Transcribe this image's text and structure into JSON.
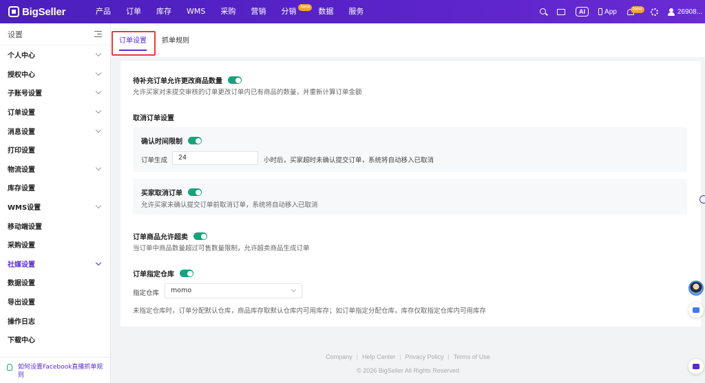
{
  "brand": {
    "name": "BigSeller"
  },
  "nav": {
    "items": [
      {
        "label": "产品"
      },
      {
        "label": "订单"
      },
      {
        "label": "库存"
      },
      {
        "label": "WMS"
      },
      {
        "label": "采购"
      },
      {
        "label": "营销"
      },
      {
        "label": "分销",
        "badge": "New"
      },
      {
        "label": "数据"
      },
      {
        "label": "服务"
      }
    ]
  },
  "topright": {
    "ai_label": "AI",
    "app_label": "App",
    "bell_badge": "New",
    "user_id": "26908..."
  },
  "sidebar": {
    "title": "设置",
    "items": [
      {
        "label": "个人中心",
        "chevron": true
      },
      {
        "label": "授权中心",
        "chevron": true
      },
      {
        "label": "子账号设置",
        "chevron": true
      },
      {
        "label": "订单设置",
        "chevron": true
      },
      {
        "label": "消息设置",
        "chevron": true
      },
      {
        "label": "打印设置",
        "chevron": false
      },
      {
        "label": "物流设置",
        "chevron": true
      },
      {
        "label": "库存设置",
        "chevron": false
      },
      {
        "label": "WMS设置",
        "chevron": true
      },
      {
        "label": "移动端设置",
        "chevron": false
      },
      {
        "label": "采购设置",
        "chevron": false
      },
      {
        "label": "社媒设置",
        "chevron": true,
        "active": true
      },
      {
        "label": "数据设置",
        "chevron": false
      },
      {
        "label": "导出设置",
        "chevron": false
      },
      {
        "label": "操作日志",
        "chevron": false
      },
      {
        "label": "下载中心",
        "chevron": false
      }
    ],
    "help_link": "如何设置Facebook直播抓单规则"
  },
  "tabs": [
    {
      "label": "订单设置",
      "active": true
    },
    {
      "label": "抓单规则",
      "active": false
    }
  ],
  "settings": {
    "pending_edit": {
      "title": "待补充订单允许更改商品数量",
      "enabled": true,
      "desc": "允许买家对未提交审核的订单更改订单内已有商品的数量，并重新计算订单金额"
    },
    "cancel_section": {
      "title": "取消订单设置",
      "confirm": {
        "title": "确认时间限制",
        "enabled": true,
        "prefix": "订单生成",
        "hours": "24",
        "suffix": "小时后，买家超时未确认提交订单，系统将自动移入已取消"
      },
      "buyer_cancel": {
        "title": "买家取消订单",
        "enabled": true,
        "desc": "允许买家未确认提交订单前取消订单，系统将自动移入已取消"
      }
    },
    "oversell": {
      "title": "订单商品允许超卖",
      "enabled": true,
      "desc": "当订单中商品数量超过可售数量限制，允许超卖商品生成订单"
    },
    "warehouse": {
      "title": "订单指定仓库",
      "enabled": true,
      "label": "指定仓库",
      "value": "momo",
      "desc": "未指定仓库时，订单分配默认仓库，商品库存取默认仓库内可用库存；如订单指定分配仓库，库存仅取指定仓库内可用库存"
    }
  },
  "footer": {
    "links": [
      "Company",
      "Help Center",
      "Privacy Policy",
      "Terms of Use"
    ],
    "copyright": "© 2026 BigSeller All Rights Reserved"
  },
  "colors": {
    "brand_purple": "#5b2bd3",
    "toggle_green": "#16a37b",
    "highlight_red": "#e23b3b"
  }
}
